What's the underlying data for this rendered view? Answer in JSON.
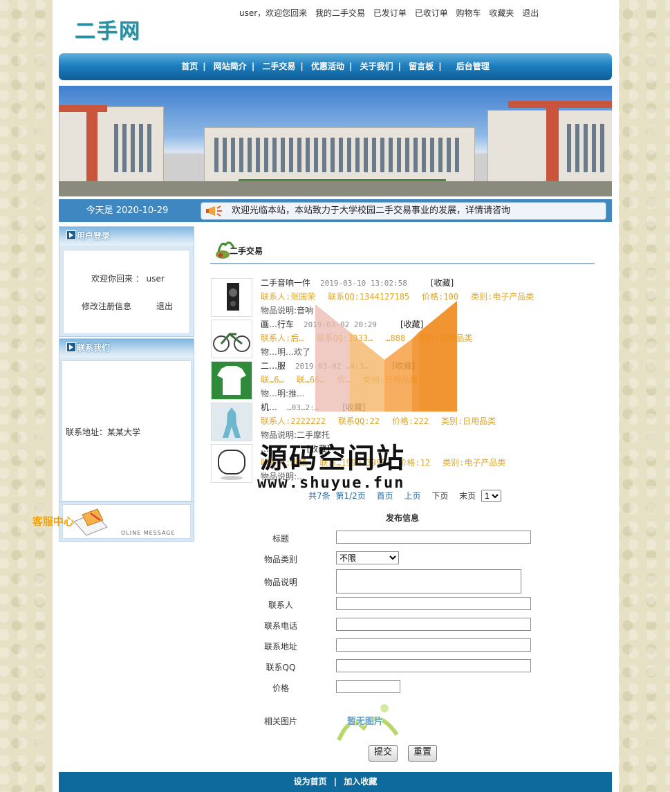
{
  "header": {
    "logo": "二手网",
    "greeting": "user，欢迎您回来",
    "links": [
      "我的二手交易",
      "已发订单",
      "已收订单",
      "购物车",
      "收藏夹",
      "退出"
    ]
  },
  "nav": {
    "items": [
      "首页",
      "网站简介",
      "二手交易",
      "优惠活动",
      "关于我们",
      "留言板",
      "后台管理"
    ]
  },
  "date_bar": {
    "date": "今天是 2020-10-29",
    "notice": "欢迎光临本站，本站致力于大学校园二手交易事业的发展，详情请咨询"
  },
  "sidebar": {
    "login": {
      "title": "用户登录",
      "welcome": "欢迎你回来 ： user",
      "edit_link": "修改注册信息",
      "logout_link": "退出"
    },
    "contact": {
      "title": "联系我们",
      "address": "联系地址：某某大学"
    },
    "online_message": "OLINE MESSAGE",
    "service": "客服中心"
  },
  "section": {
    "title": "二手交易"
  },
  "items": [
    {
      "name": "二手音响一件",
      "time": "2019-03-10 13:02:58",
      "fav": "[收藏]",
      "contact": "联系人:张国荣",
      "qq": "联系QQ:1344127185",
      "price": "价格:100",
      "category": "类别:电子产品类",
      "desc": "物品说明:音响"
    },
    {
      "name": "画…行车",
      "time": "2019-03-02 20:29",
      "fav": "[收藏]",
      "contact": "联系人:后…",
      "qq": "联系QQ:3333…",
      "price": "…888",
      "category": "类别:日用品类",
      "desc": "物…明…欢了"
    },
    {
      "name": "二…服",
      "time": "2019-03-02 …4:3…",
      "fav": "[收藏]",
      "contact": "联…6…",
      "qq": "联…66…",
      "price": "价…",
      "category": "类别:日用品类",
      "desc": "物…明:推…"
    },
    {
      "name": "机…",
      "time": "…03…2:…",
      "fav": "[收藏]",
      "contact": "联系人:2222222",
      "qq": "联系QQ:22",
      "price": "价格:222",
      "category": "类别:日用品类",
      "desc": "物品说明:二手摩托"
    },
    {
      "name": "…",
      "time": "…",
      "fav": "[收藏]",
      "contact": "联系人:阿杨",
      "qq": "联系…1999…3993",
      "price": "价格:12",
      "category": "类别:电子产品类",
      "desc": "物品说明:…"
    }
  ],
  "pager": {
    "total": "共7条",
    "page": "第1/2页",
    "first": "首页",
    "prev": "上页",
    "next": "下页",
    "last": "末页",
    "selected": "1"
  },
  "form": {
    "title": "发布信息",
    "labels": [
      "标题",
      "物品类别",
      "物品说明",
      "联系人",
      "联系电话",
      "联系地址",
      "联系QQ",
      "价格",
      "相关图片"
    ],
    "category_selected": "不限",
    "no_image": "暂无图片",
    "submit": "提交",
    "reset": "重置"
  },
  "footer": {
    "set_home": "设为首页",
    "separator": "|",
    "add_fav": "加入收藏"
  },
  "watermark": {
    "title": "源码空间站",
    "url": "www.shuyue.fun"
  }
}
